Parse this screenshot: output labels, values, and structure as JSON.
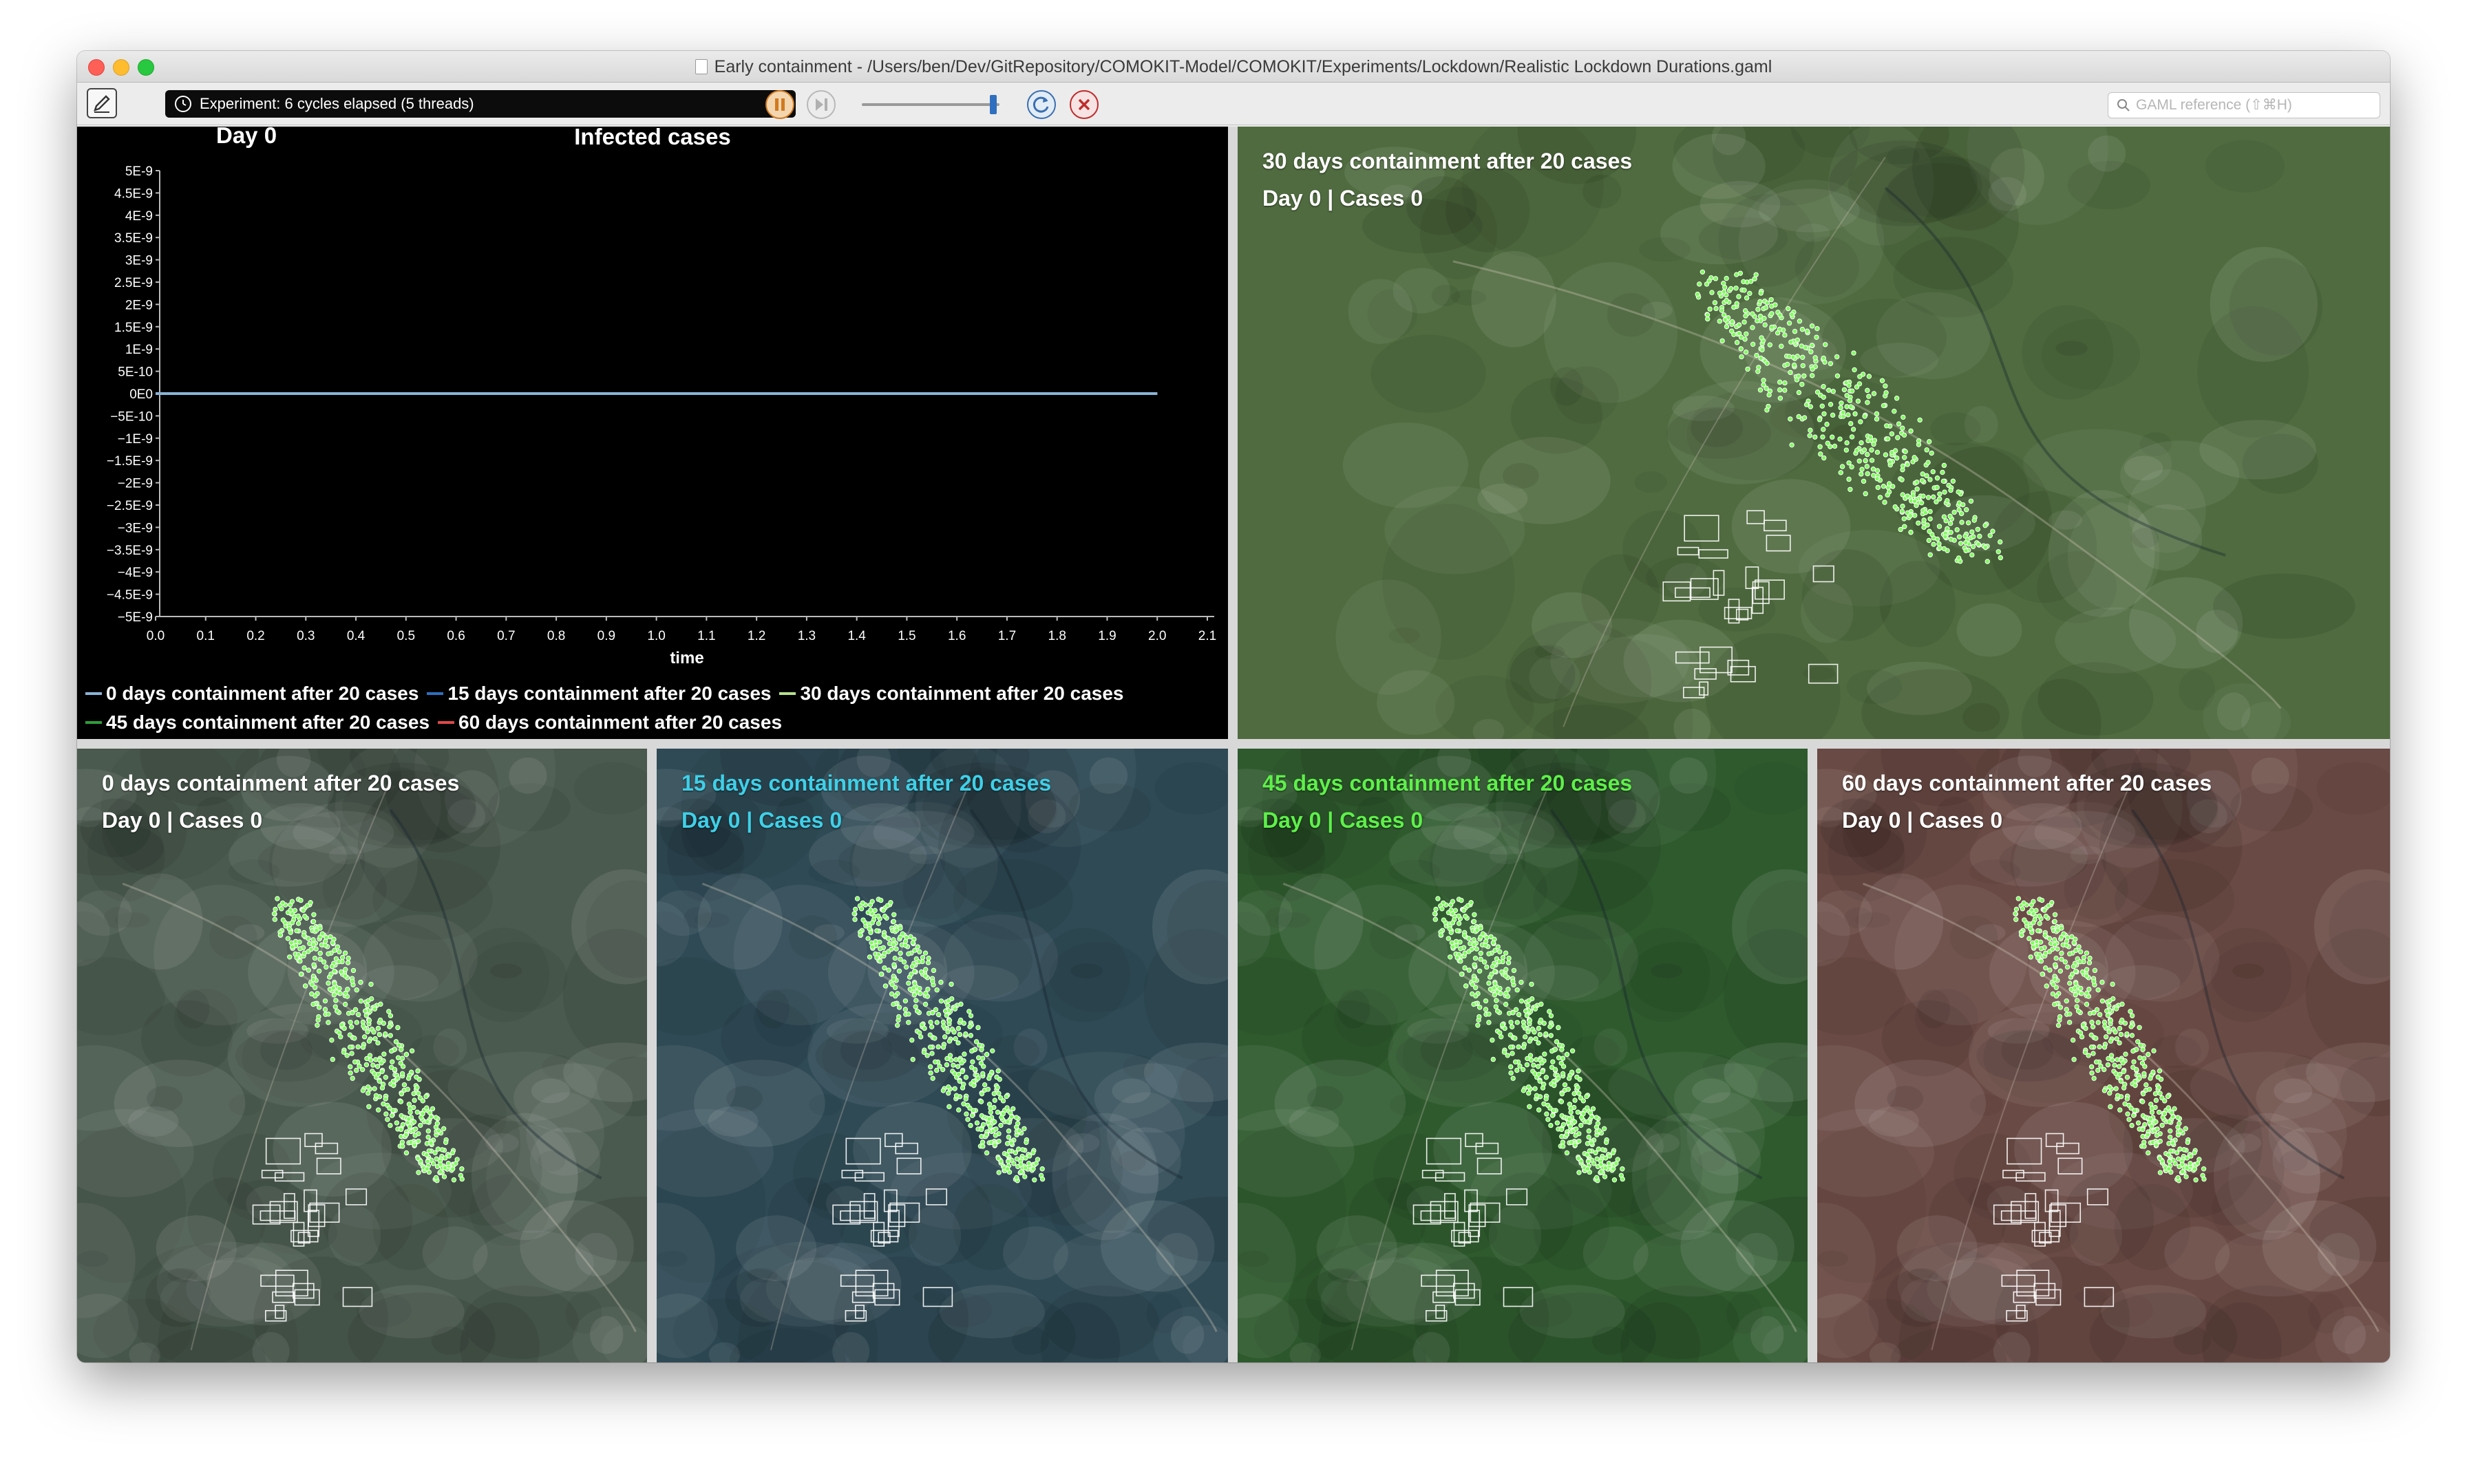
{
  "window": {
    "title": "Early containment - /Users/ben/Dev/GitRepository/COMOKIT-Model/COMOKIT/Experiments/Lockdown/Realistic Lockdown Durations.gaml"
  },
  "toolbar": {
    "status_text": "Experiment: 6 cycles elapsed (5 threads)",
    "search_placeholder": "GAML reference (⇧⌘H)",
    "icons": [
      "edit-icon",
      "clock-icon",
      "pause-icon",
      "step-icon",
      "reload-icon",
      "close-icon",
      "search-icon"
    ],
    "colors": {
      "status_bg": "#0c0c0c",
      "pause": "#d07a20",
      "reload": "#3b6fb0",
      "close": "#c02b2b"
    }
  },
  "chart": {
    "day_label": "Day 0"
  },
  "chart_data": {
    "type": "line",
    "title": "Infected cases",
    "xlabel": "time",
    "ylabel": "",
    "xlim": [
      0.0,
      2.1
    ],
    "ylim": [
      -5e-09,
      5e-09
    ],
    "x_ticks": [
      "0.0",
      "0.1",
      "0.2",
      "0.3",
      "0.4",
      "0.5",
      "0.6",
      "0.7",
      "0.8",
      "0.9",
      "1.0",
      "1.1",
      "1.2",
      "1.3",
      "1.4",
      "1.5",
      "1.6",
      "1.7",
      "1.8",
      "1.9",
      "2.0",
      "2.1"
    ],
    "y_ticks": [
      "5E-9",
      "4.5E-9",
      "4E-9",
      "3.5E-9",
      "3E-9",
      "2.5E-9",
      "2E-9",
      "1.5E-9",
      "1E-9",
      "5E-10",
      "0E0",
      "−5E-10",
      "−1E-9",
      "−1.5E-9",
      "−2E-9",
      "−2.5E-9",
      "−3E-9",
      "−3.5E-9",
      "−4E-9",
      "−4.5E-9",
      "−5E-9"
    ],
    "legend_placement": "bottom",
    "grid": false,
    "series": [
      {
        "name": "0 days containment after 20 cases",
        "color": "#8ab4d8",
        "x": [
          0.0,
          2.0
        ],
        "y": [
          0,
          0
        ]
      },
      {
        "name": "15 days containment after 20 cases",
        "color": "#2f6fbf",
        "x": [
          0.0,
          2.0
        ],
        "y": [
          0,
          0
        ]
      },
      {
        "name": "30 days containment after 20 cases",
        "color": "#b7e08a",
        "x": [
          0.0,
          2.0
        ],
        "y": [
          0,
          0
        ]
      },
      {
        "name": "45 days containment after 20 cases",
        "color": "#2f9d3a",
        "x": [
          0.0,
          2.0
        ],
        "y": [
          0,
          0
        ]
      },
      {
        "name": "60 days containment after 20 cases",
        "color": "#e04848",
        "x": [
          0.0,
          2.0
        ],
        "y": [
          0,
          0
        ]
      }
    ]
  },
  "maps": {
    "top": {
      "title": "30 days containment after 20 cases",
      "subtitle": "Day 0 | Cases 0",
      "text_color": "#ffffff",
      "tint": "#4f6b3f"
    },
    "b1": {
      "title": "0 days containment after 20 cases",
      "subtitle": "Day 0 | Cases 0",
      "text_color": "#ffffff",
      "tint": "#4a5a4e"
    },
    "b2": {
      "title": "15 days containment after 20 cases",
      "subtitle": "Day 0 | Cases 0",
      "text_color": "#3fd0e8",
      "tint": "#2f4a55"
    },
    "b3": {
      "title": "45 days containment after 20 cases",
      "subtitle": "Day 0 | Cases 0",
      "text_color": "#5ef04a",
      "tint": "#2f5a2e"
    },
    "b4": {
      "title": "60 days containment after 20 cases",
      "subtitle": "Day 0 | Cases 0",
      "text_color": "#ffffff",
      "tint": "#6a4a44"
    }
  }
}
